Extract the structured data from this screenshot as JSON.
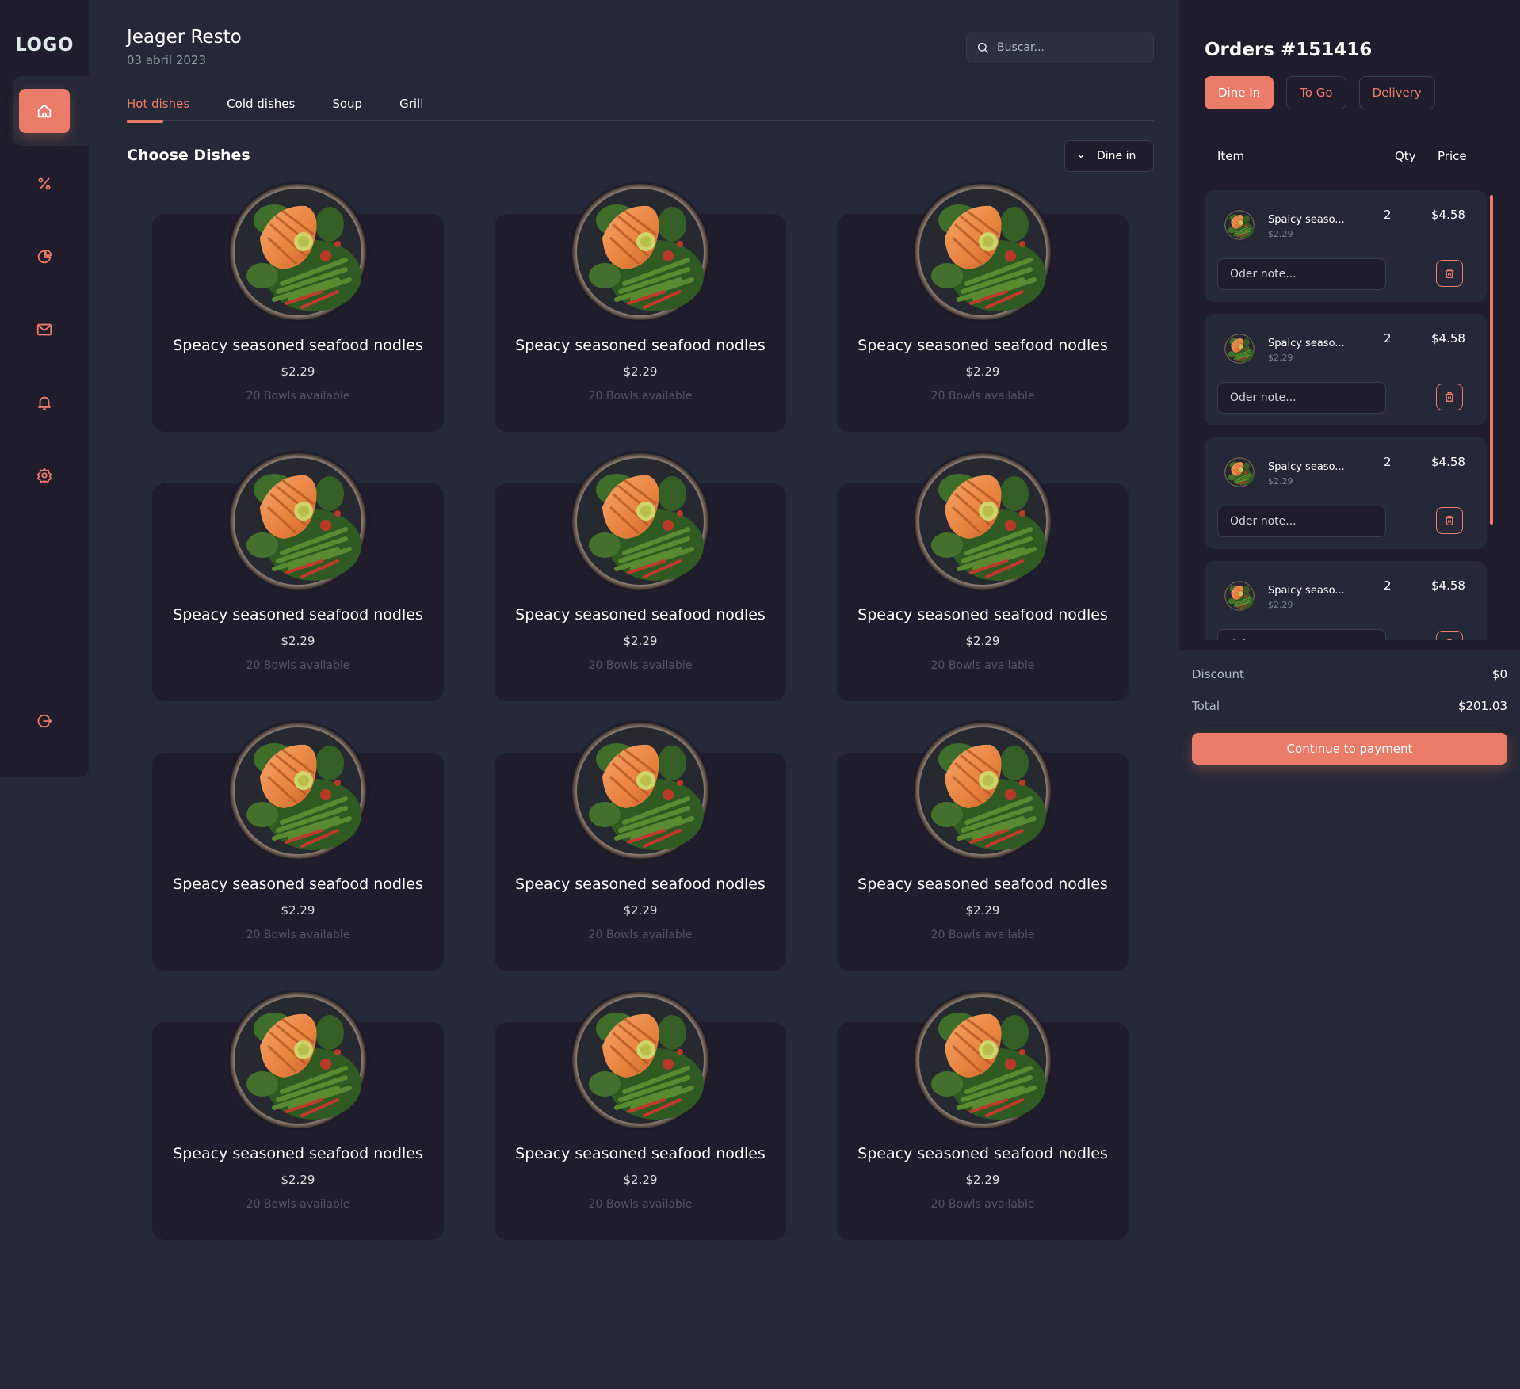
{
  "sidebar": {
    "logo": "LOGO",
    "items": [
      {
        "name": "home-icon",
        "active": true
      },
      {
        "name": "discount-icon",
        "active": false
      },
      {
        "name": "dashboard-icon",
        "active": false
      },
      {
        "name": "message-icon",
        "active": false
      },
      {
        "name": "notification-icon",
        "active": false
      },
      {
        "name": "settings-icon",
        "active": false
      },
      {
        "name": "logout-icon",
        "active": false
      }
    ]
  },
  "header": {
    "title": "Jeager Resto",
    "date": "03 abril 2023",
    "search_placeholder": "Buscar..."
  },
  "tabs": [
    "Hot dishes",
    "Cold dishes",
    "Soup",
    "Grill"
  ],
  "section_title": "Choose Dishes",
  "dine_select": "Dine in",
  "dishes": [
    {
      "name": "Speacy seasoned seafood nodles",
      "price": "$2.29",
      "availability": "20 Bowls available"
    },
    {
      "name": "Speacy seasoned seafood nodles",
      "price": "$2.29",
      "availability": "20 Bowls available"
    },
    {
      "name": "Speacy seasoned seafood nodles",
      "price": "$2.29",
      "availability": "20 Bowls available"
    },
    {
      "name": "Speacy seasoned seafood nodles",
      "price": "$2.29",
      "availability": "20 Bowls available"
    },
    {
      "name": "Speacy seasoned seafood nodles",
      "price": "$2.29",
      "availability": "20 Bowls available"
    },
    {
      "name": "Speacy seasoned seafood nodles",
      "price": "$2.29",
      "availability": "20 Bowls available"
    },
    {
      "name": "Speacy seasoned seafood nodles",
      "price": "$2.29",
      "availability": "20 Bowls available"
    },
    {
      "name": "Speacy seasoned seafood nodles",
      "price": "$2.29",
      "availability": "20 Bowls available"
    },
    {
      "name": "Speacy seasoned seafood nodles",
      "price": "$2.29",
      "availability": "20 Bowls available"
    },
    {
      "name": "Speacy seasoned seafood nodles",
      "price": "$2.29",
      "availability": "20 Bowls available"
    },
    {
      "name": "Speacy seasoned seafood nodles",
      "price": "$2.29",
      "availability": "20 Bowls available"
    },
    {
      "name": "Speacy seasoned seafood nodles",
      "price": "$2.29",
      "availability": "20 Bowls available"
    }
  ],
  "order": {
    "title": "Orders #151416",
    "types": [
      {
        "label": "Dine In",
        "active": true
      },
      {
        "label": "To Go",
        "active": false
      },
      {
        "label": "Delivery",
        "active": false
      }
    ],
    "columns": {
      "item": "Item",
      "qty": "Qty",
      "price": "Price"
    },
    "items": [
      {
        "name": "Spaicy seaso...",
        "unit_price": "$2.29",
        "qty": "2",
        "total": "$4.58",
        "note_placeholder": "Oder note..."
      },
      {
        "name": "Spaicy seaso...",
        "unit_price": "$2.29",
        "qty": "2",
        "total": "$4.58",
        "note_placeholder": "Oder note..."
      },
      {
        "name": "Spaicy seaso...",
        "unit_price": "$2.29",
        "qty": "2",
        "total": "$4.58",
        "note_placeholder": "Oder note..."
      },
      {
        "name": "Spaicy seaso...",
        "unit_price": "$2.29",
        "qty": "2",
        "total": "$4.58",
        "note_placeholder": "Oder note..."
      }
    ],
    "discount_label": "Discount",
    "discount_value": "$0",
    "total_label": "Total",
    "total_value": "$201.03",
    "pay_button": "Continue to payment"
  },
  "colors": {
    "accent": "#ea7c69",
    "background": "#252836",
    "panel": "#1f1d2b"
  }
}
